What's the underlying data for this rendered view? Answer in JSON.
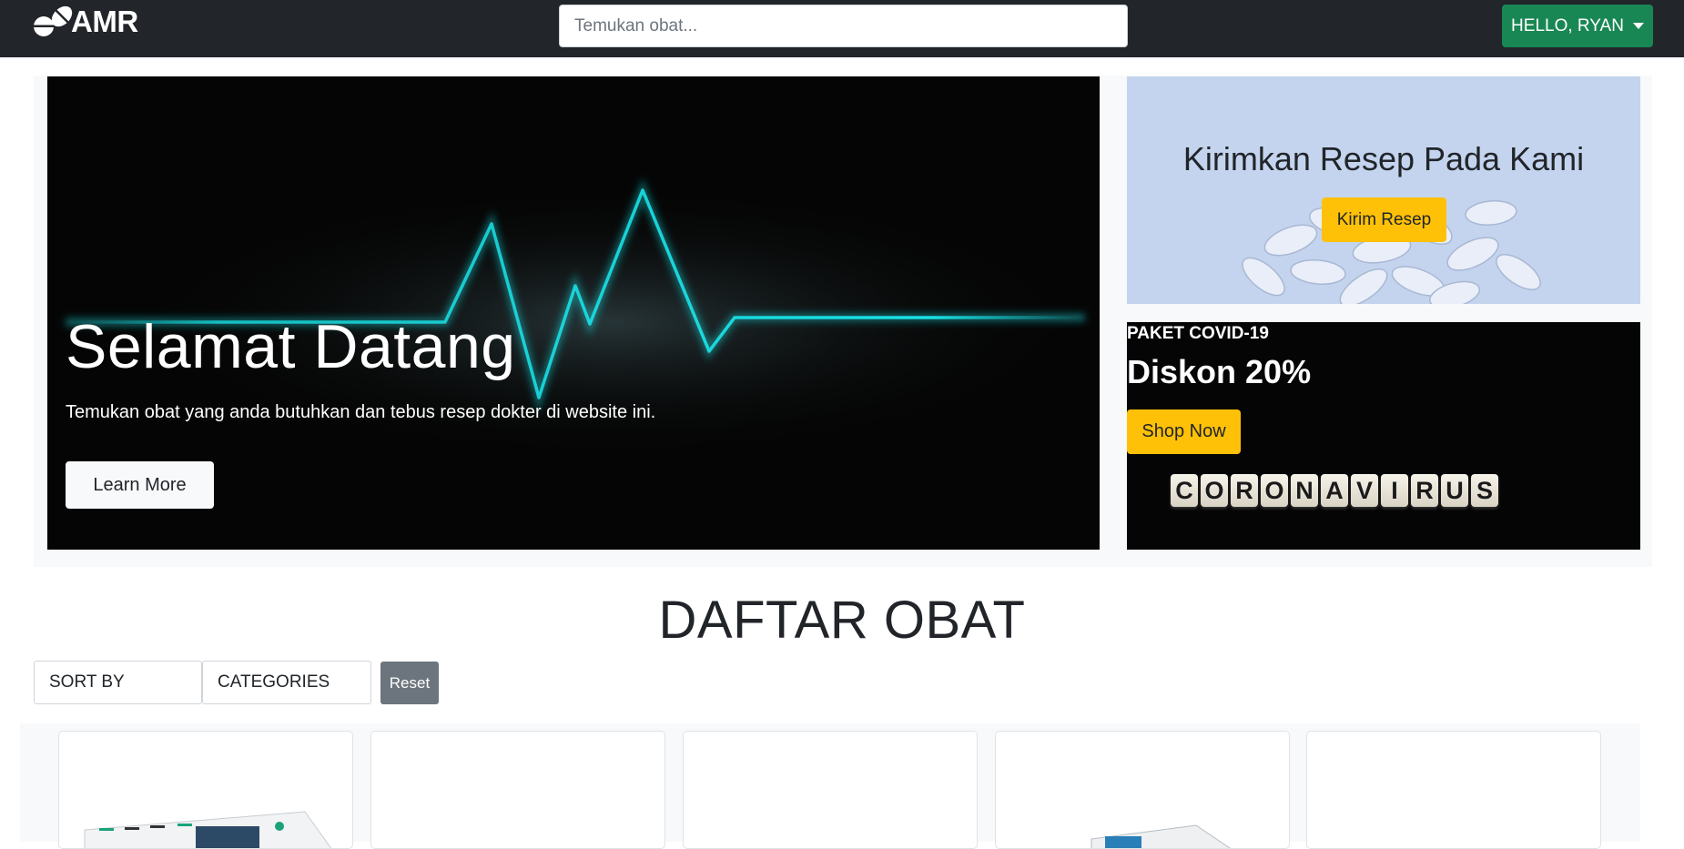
{
  "navbar": {
    "brand": "AMR",
    "search_placeholder": "Temukan obat...",
    "user_label": "HELLO, RYAN"
  },
  "hero": {
    "title": "Selamat Datang",
    "subtitle": "Temukan obat yang anda butuhkan dan tebus resep dokter di website ini.",
    "button": "Learn More"
  },
  "promo_resep": {
    "title": "Kirimkan Resep Pada Kami",
    "button": "Kirim Resep"
  },
  "promo_covid": {
    "label": "PAKET COVID-19",
    "title": "Diskon 20%",
    "button": "Shop Now",
    "tiles": [
      "C",
      "O",
      "R",
      "O",
      "N",
      "A",
      "V",
      "I",
      "R",
      "U",
      "S"
    ]
  },
  "list": {
    "title": "DAFTAR OBAT",
    "sort_label": "SORT BY",
    "categories_label": "CATEGORIES",
    "reset_label": "Reset"
  },
  "colors": {
    "navbar": "#222529",
    "success": "#198754",
    "warning": "#ffc107",
    "secondary": "#6c757d",
    "pulse": "#19f0f5"
  }
}
